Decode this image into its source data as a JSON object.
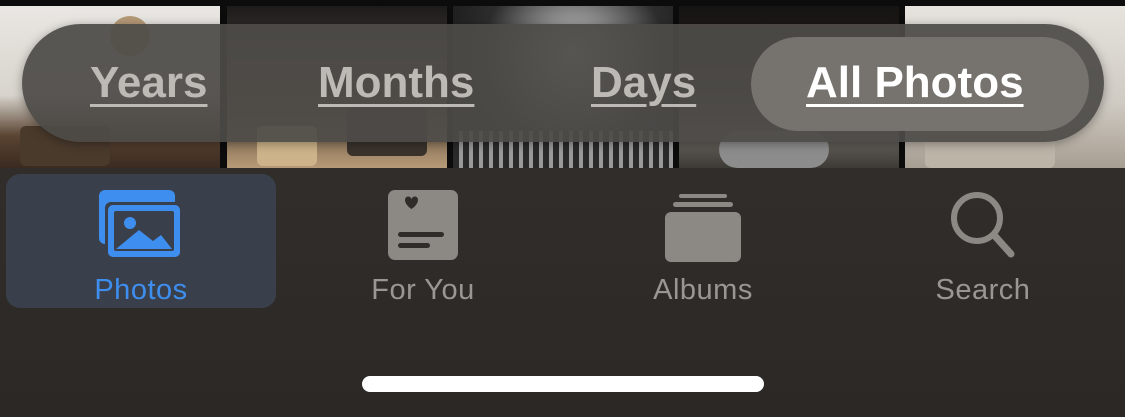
{
  "segments": {
    "years": "Years",
    "months": "Months",
    "days": "Days",
    "all_photos": "All Photos",
    "selected": "All Photos"
  },
  "tabs": [
    {
      "label": "Photos",
      "icon": "photos-icon",
      "active": true
    },
    {
      "label": "For You",
      "icon": "for-you-icon",
      "active": false
    },
    {
      "label": "Albums",
      "icon": "albums-icon",
      "active": false
    },
    {
      "label": "Search",
      "icon": "search-icon",
      "active": false
    }
  ],
  "colors": {
    "accent": "#3e8ef0",
    "inactive": "#9a9692",
    "segment_text": "#bdb9b5",
    "segment_selected_text": "#ffffff"
  }
}
